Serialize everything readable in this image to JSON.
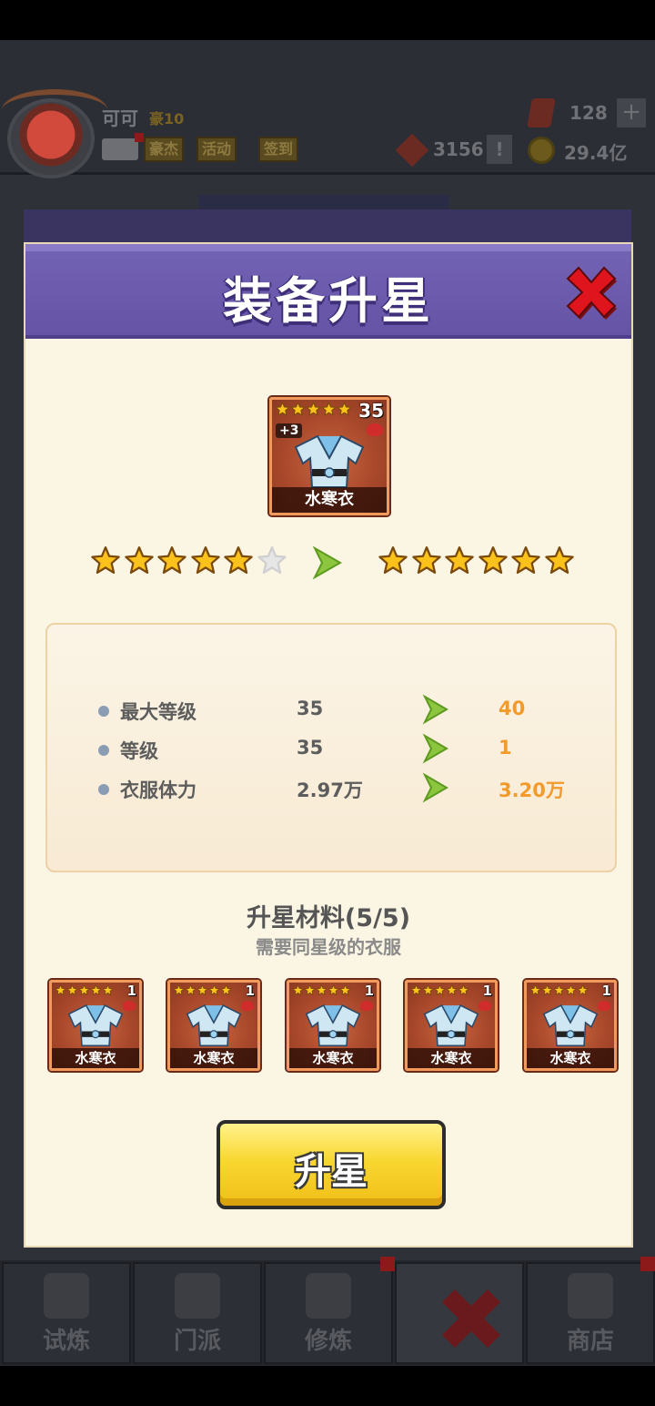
{
  "hud": {
    "player_name": "可可",
    "vip_label": "豪10",
    "tags": [
      "豪杰",
      "活动",
      "签到"
    ],
    "gems": "128",
    "plus": "+",
    "tokens": "3156",
    "alert": "!",
    "coins": "29.4亿"
  },
  "bottom_nav": {
    "items": [
      "试炼",
      "门派",
      "修炼",
      "",
      "商店"
    ]
  },
  "modal": {
    "title": "装备升星",
    "item": {
      "name": "水寒衣",
      "level": "35",
      "plus": "+3",
      "stars": 5
    },
    "stars_before": {
      "filled": 5,
      "total": 6
    },
    "stars_after": {
      "filled": 6,
      "total": 6
    },
    "stats": [
      {
        "name": "最大等级",
        "old": "35",
        "new": "40"
      },
      {
        "name": "等级",
        "old": "35",
        "new": "1"
      },
      {
        "name": "衣服体力",
        "old": "2.97万",
        "new": "3.20万"
      }
    ],
    "materials_title": "升星材料(5/5)",
    "materials_sub": "需要同星级的衣服",
    "materials": [
      {
        "name": "水寒衣",
        "level": "1",
        "stars": 5
      },
      {
        "name": "水寒衣",
        "level": "1",
        "stars": 5
      },
      {
        "name": "水寒衣",
        "level": "1",
        "stars": 5
      },
      {
        "name": "水寒衣",
        "level": "1",
        "stars": 5
      },
      {
        "name": "水寒衣",
        "level": "1",
        "stars": 5
      }
    ],
    "upgrade_label": "升星"
  },
  "colors": {
    "header_purple": "#6553a6",
    "panel_cream": "#fbf5e4",
    "stat_new_orange": "#f29a2a",
    "button_yellow": "#f8d731",
    "close_red": "#e0141c"
  }
}
